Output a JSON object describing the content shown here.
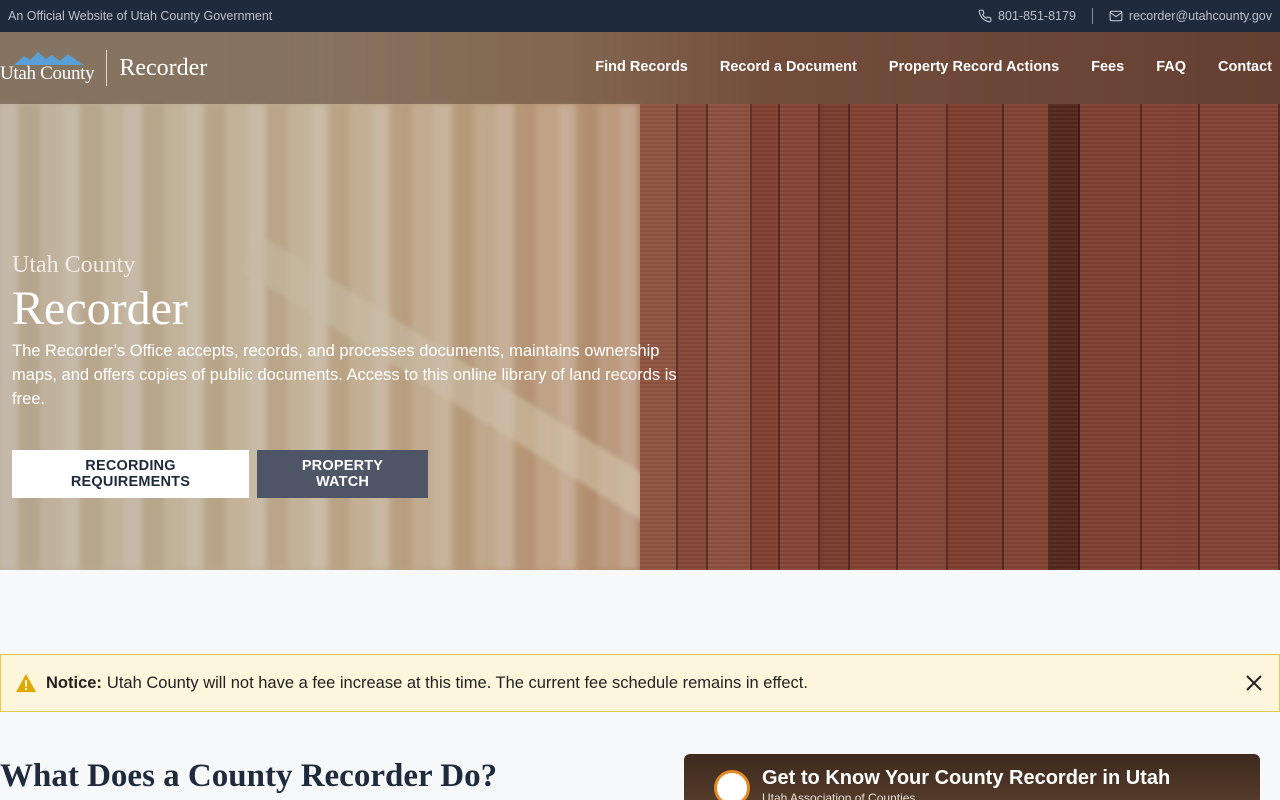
{
  "topbar": {
    "official": "An Official Website of Utah County Government",
    "phone": "801-851-8179",
    "email": "recorder@utahcounty.gov"
  },
  "header": {
    "logo_county": "Utah County",
    "logo_office": "Recorder",
    "nav": [
      "Find Records",
      "Record a Document",
      "Property Record Actions",
      "Fees",
      "FAQ",
      "Contact"
    ]
  },
  "hero": {
    "subtitle": "Utah County",
    "title": "Recorder",
    "description": "The Recorder’s Office accepts, records, and processes documents, maintains ownership maps, and offers copies of public documents. Access to this online library of land records is free.",
    "buttons": [
      "RECORDING REQUIREMENTS",
      "PROPERTY WATCH"
    ]
  },
  "notice": {
    "label": "Notice:",
    "text": "Utah County will not have a fee increase at this time. The current fee schedule remains in effect."
  },
  "main": {
    "section_title": "What Does a County Recorder Do?",
    "video_title": "Get to Know Your County Recorder in Utah",
    "video_channel": "Utah Association of Counties"
  },
  "colors": {
    "topbar_bg": "#1f2a3c",
    "notice_bg": "#fdf6dc",
    "notice_border": "#e6c84a",
    "warning_icon": "#e0a800"
  },
  "icons": [
    "phone-icon",
    "mail-icon",
    "mountain-logo-icon",
    "warning-icon",
    "close-icon",
    "document-icon"
  ]
}
